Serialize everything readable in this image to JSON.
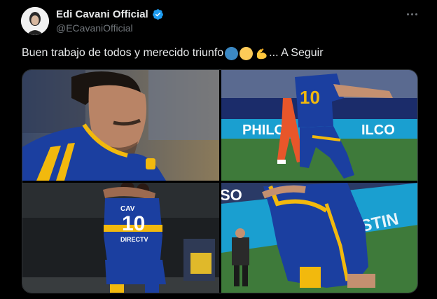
{
  "author": {
    "display_name": "Edi Cavani Official",
    "handle": "@ECavaniOfficial",
    "verified": true,
    "avatar_icon": "profile-photo"
  },
  "tweet": {
    "text": "Buen trabajo de todos y merecido triunfo",
    "text_suffix": "... A Seguir",
    "emojis": [
      "blue-circle",
      "yellow-circle",
      "flexed-biceps"
    ]
  },
  "photos": {
    "photo1": {
      "jersey_number": ""
    },
    "photo2": {
      "jersey_number": "10",
      "banner_text": "PHILO",
      "banner_text_2": "ILCO"
    },
    "photo3": {
      "jersey_number": "10",
      "shirt_name": "CAV",
      "sponsor": "DIRECTV"
    },
    "photo4": {
      "banner_text": "DISTIN",
      "corner_text": "SO"
    }
  },
  "colors": {
    "background": "#000000",
    "text_primary": "#e7e9ea",
    "text_secondary": "#71767b",
    "verified_blue": "#1d9bf0",
    "boca_blue": "#1b3fa0",
    "boca_yellow": "#f2b90d"
  }
}
